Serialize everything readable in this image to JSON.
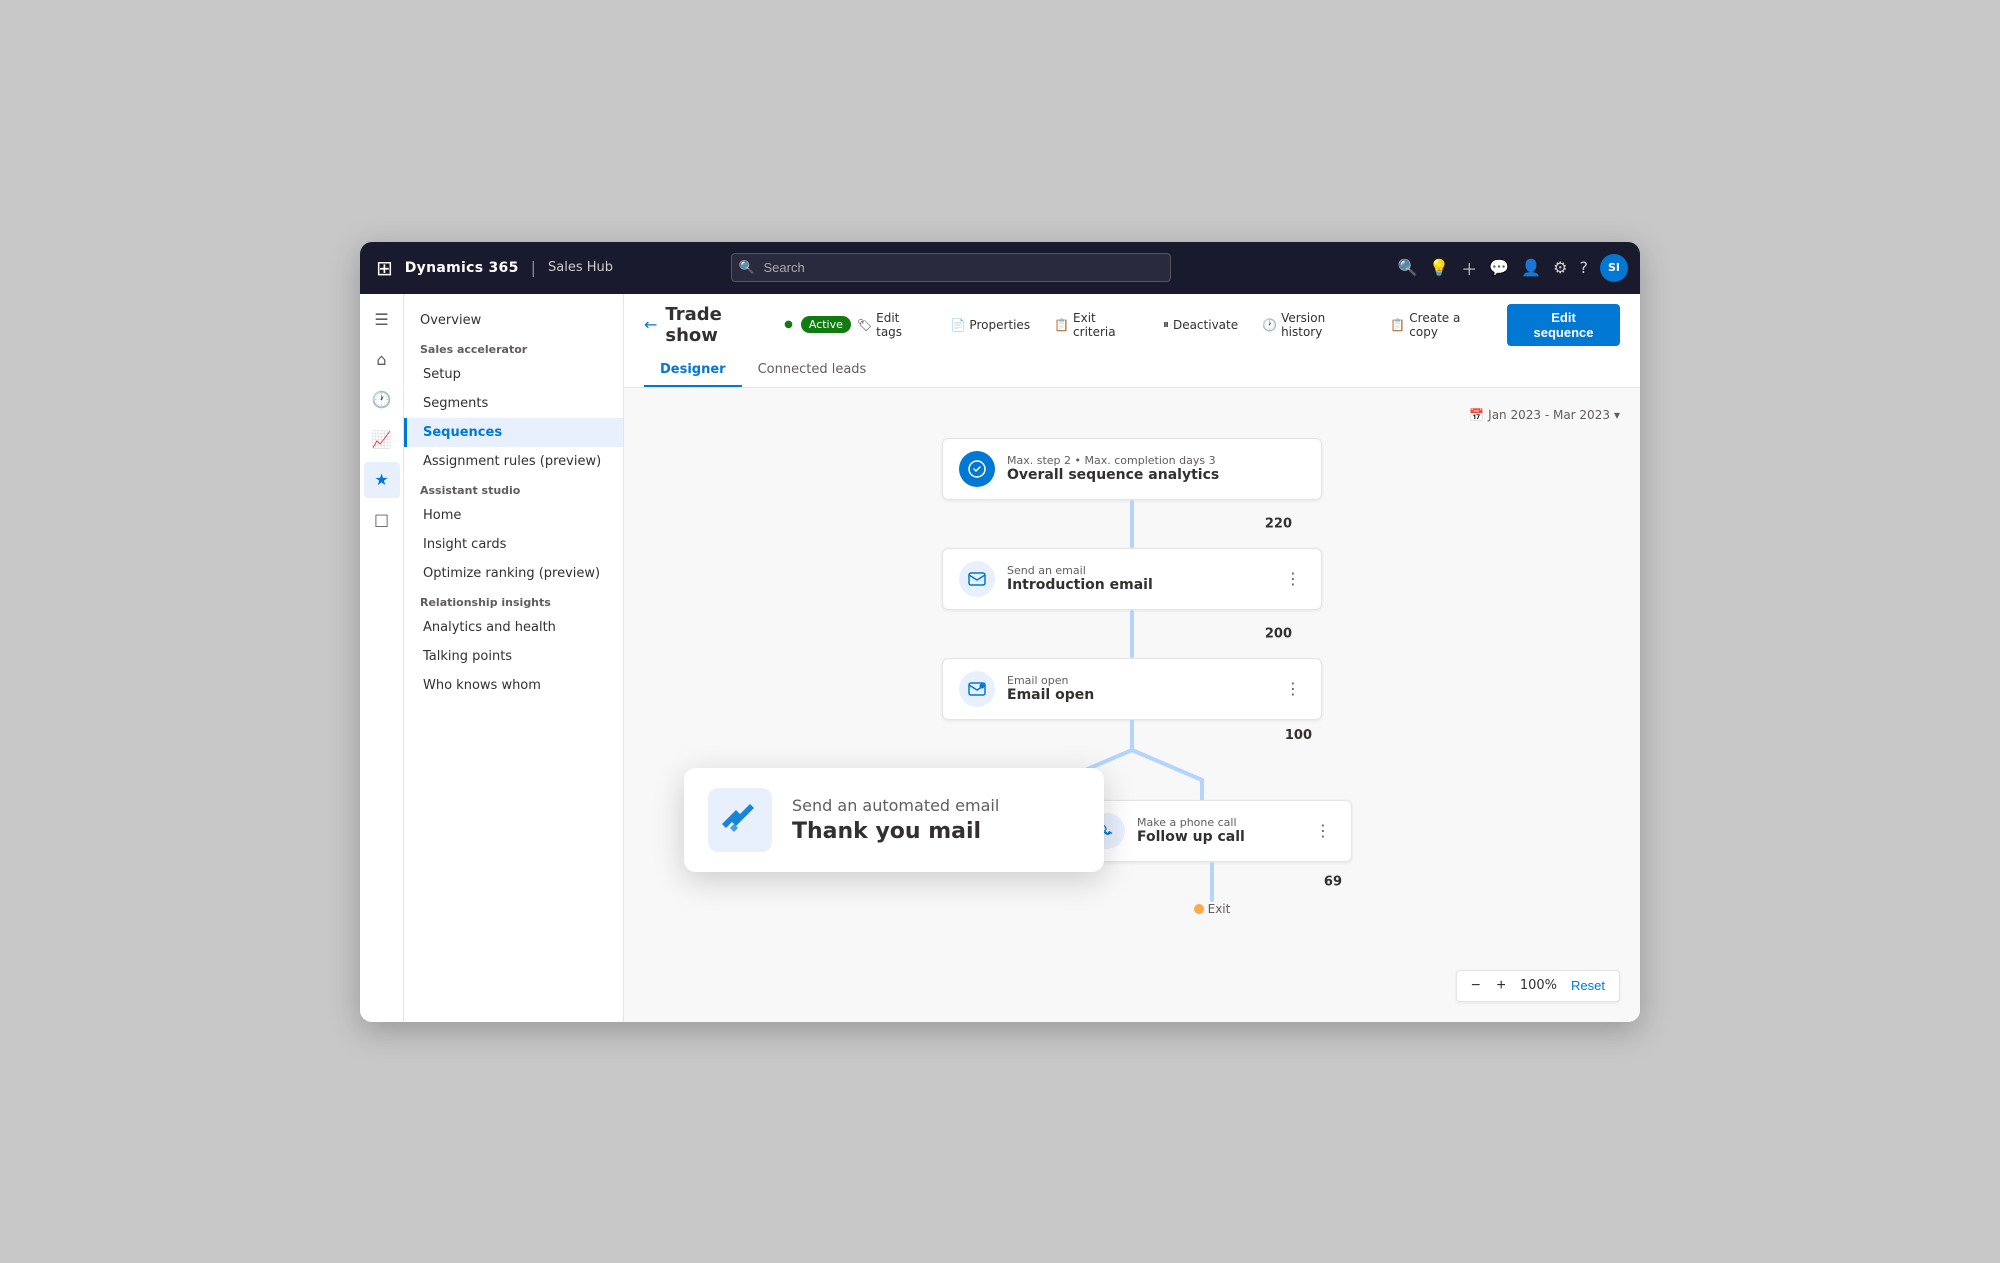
{
  "topnav": {
    "brand": "Dynamics 365",
    "divider": "|",
    "app": "Sales Hub",
    "search_placeholder": "Search",
    "avatar_initials": "SI"
  },
  "sidebar_icons": [
    {
      "name": "menu-icon",
      "icon": "☰"
    },
    {
      "name": "home-icon",
      "icon": "⌂"
    },
    {
      "name": "clock-icon",
      "icon": "🕐"
    },
    {
      "name": "chart-icon",
      "icon": "📊"
    },
    {
      "name": "star-icon",
      "icon": "★"
    },
    {
      "name": "box-icon",
      "icon": "□"
    }
  ],
  "nav": {
    "top_item": "Overview",
    "sections": [
      {
        "label": "Sales accelerator",
        "items": [
          "Setup",
          "Segments",
          "Sequences",
          "Assignment rules (preview)"
        ]
      },
      {
        "label": "Assistant studio",
        "items": [
          "Home",
          "Insight cards",
          "Optimize ranking (preview)"
        ]
      },
      {
        "label": "Relationship insights",
        "items": [
          "Analytics and health",
          "Talking points",
          "Who knows whom"
        ]
      }
    ],
    "active_item": "Sequences"
  },
  "page": {
    "back_label": "←",
    "title": "Trade show",
    "status": "Active",
    "actions": [
      {
        "label": "Edit tags",
        "icon": "🏷"
      },
      {
        "label": "Properties",
        "icon": "📄"
      },
      {
        "label": "Exit criteria",
        "icon": "📋"
      },
      {
        "label": "Deactivate",
        "icon": "⏸"
      },
      {
        "label": "Version history",
        "icon": "🕐"
      },
      {
        "label": "Create a copy",
        "icon": "📋"
      }
    ],
    "edit_sequence_label": "Edit sequence",
    "tabs": [
      {
        "label": "Designer",
        "active": true
      },
      {
        "label": "Connected leads",
        "active": false
      }
    ]
  },
  "designer": {
    "date_filter": "Jan 2023 - Mar 2023",
    "flow": {
      "analytics_card": {
        "meta": "Max. step 2 • Max. completion days 3",
        "title": "Overall sequence analytics",
        "value": 220
      },
      "intro_email_card": {
        "subtitle": "Send an email",
        "title": "Introduction email",
        "value": 200
      },
      "email_open_card": {
        "subtitle": "Email open",
        "title": "Email open",
        "value": 100
      },
      "follow_up_card": {
        "subtitle": "Make a phone call",
        "title": "Follow up call",
        "value": 69
      },
      "exit_label": "Exit"
    },
    "tooltip": {
      "subtitle": "Send an automated email",
      "title": "Thank you mail"
    },
    "zoom": {
      "minus": "−",
      "plus": "+",
      "level": "100%",
      "reset": "Reset"
    }
  }
}
